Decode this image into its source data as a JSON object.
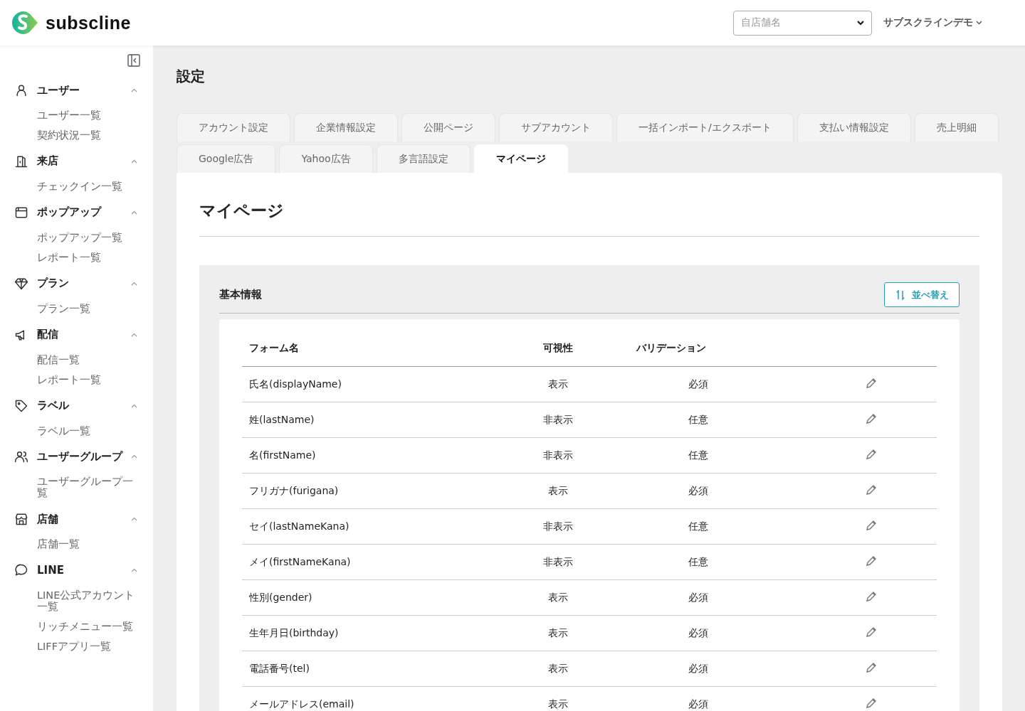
{
  "header": {
    "logo": "subscline",
    "store_select": {
      "placeholder": "自店舗名"
    },
    "account_menu": "サブスクラインデモ"
  },
  "sidebar": {
    "groups": [
      {
        "kind": "user",
        "label": "ユーザー",
        "expanded": true,
        "items": [
          "ユーザー一覧",
          "契約状況一覧"
        ]
      },
      {
        "kind": "door",
        "label": "来店",
        "expanded": true,
        "items": [
          "チェックイン一覧"
        ]
      },
      {
        "kind": "window",
        "label": "ポップアップ",
        "expanded": true,
        "items": [
          "ポップアップ一覧",
          "レポート一覧"
        ]
      },
      {
        "kind": "diamond",
        "label": "プラン",
        "expanded": true,
        "items": [
          "プラン一覧"
        ]
      },
      {
        "kind": "megaphone",
        "label": "配信",
        "expanded": true,
        "items": [
          "配信一覧",
          "レポート一覧"
        ]
      },
      {
        "kind": "tag",
        "label": "ラベル",
        "expanded": true,
        "items": [
          "ラベル一覧"
        ]
      },
      {
        "kind": "users",
        "label": "ユーザーグループ",
        "expanded": true,
        "items": [
          "ユーザーグループ一覧"
        ]
      },
      {
        "kind": "store",
        "label": "店舗",
        "expanded": true,
        "items": [
          "店舗一覧"
        ]
      },
      {
        "kind": "chat",
        "label": "LINE",
        "expanded": true,
        "items": [
          "LINE公式アカウント一覧",
          "リッチメニュー一覧",
          "LIFFアプリ一覧"
        ]
      }
    ]
  },
  "page_title": "設定",
  "tabs": [
    [
      {
        "label": "アカウント設定",
        "selected": false
      },
      {
        "label": "企業情報設定",
        "selected": false
      },
      {
        "label": "公開ページ",
        "selected": false
      },
      {
        "label": "サブアカウント",
        "selected": false
      },
      {
        "label": "一括インポート/エクスポート",
        "selected": false
      },
      {
        "label": "支払い情報設定",
        "selected": false
      },
      {
        "label": "売上明細",
        "selected": false
      }
    ],
    [
      {
        "label": "Google広告",
        "selected": false
      },
      {
        "label": "Yahoo広告",
        "selected": false
      },
      {
        "label": "多言語設定",
        "selected": false
      },
      {
        "label": "マイページ",
        "selected": true
      }
    ]
  ],
  "card": {
    "title": "マイページ",
    "section": {
      "title": "基本情報",
      "sort_button": "並べ替え",
      "table": {
        "columns": [
          "フォーム名",
          "可視性",
          "バリデーション"
        ],
        "rows": [
          {
            "form_name": "氏名(displayName)",
            "visibility": "表示",
            "validation": "必須"
          },
          {
            "form_name": "姓(lastName)",
            "visibility": "非表示",
            "validation": "任意"
          },
          {
            "form_name": "名(firstName)",
            "visibility": "非表示",
            "validation": "任意"
          },
          {
            "form_name": "フリガナ(furigana)",
            "visibility": "表示",
            "validation": "必須"
          },
          {
            "form_name": "セイ(lastNameKana)",
            "visibility": "非表示",
            "validation": "任意"
          },
          {
            "form_name": "メイ(firstNameKana)",
            "visibility": "非表示",
            "validation": "任意"
          },
          {
            "form_name": "性別(gender)",
            "visibility": "表示",
            "validation": "必須"
          },
          {
            "form_name": "生年月日(birthday)",
            "visibility": "表示",
            "validation": "必須"
          },
          {
            "form_name": "電話番号(tel)",
            "visibility": "表示",
            "validation": "必須"
          },
          {
            "form_name": "メールアドレス(email)",
            "visibility": "表示",
            "validation": "必須"
          }
        ]
      }
    }
  }
}
